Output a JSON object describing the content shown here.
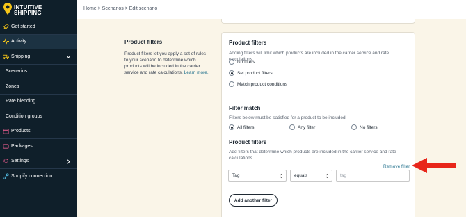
{
  "brand": {
    "line1": "INTUITIVE",
    "line2": "SHIPPING"
  },
  "sidebar": {
    "items": [
      {
        "label": "Get started",
        "icon": "rocket-icon"
      },
      {
        "label": "Activity",
        "icon": "pulse-icon"
      },
      {
        "label": "Shipping",
        "icon": "truck-icon"
      },
      {
        "label": "Scenarios"
      },
      {
        "label": "Zones"
      },
      {
        "label": "Rate blending"
      },
      {
        "label": "Condition groups"
      },
      {
        "label": "Products",
        "icon": "box-icon"
      },
      {
        "label": "Packages",
        "icon": "package-icon"
      },
      {
        "label": "Settings",
        "icon": "gear-icon"
      },
      {
        "label": "Shopify connection",
        "icon": "link-icon"
      }
    ]
  },
  "breadcrumb": "Home > Scenarios > Edit scenario",
  "description": {
    "title": "Product filters",
    "body": "Product filters let you apply a set of rules to your scenario to determine which products will be included in the carrier service and rate calculations.",
    "link": "Learn more."
  },
  "card": {
    "product_filters": {
      "title": "Product filters",
      "hint": "Adding filters will limit which products are included in the carrier service and rate calculations.",
      "options": [
        "No filters",
        "Set product filters",
        "Match product conditions"
      ],
      "selected": "Set product filters"
    },
    "filter_match": {
      "title": "Filter match",
      "hint": "Filters below must be satisfied for a product to be included.",
      "options": [
        "All filters",
        "Any filter",
        "No filters"
      ],
      "selected": "All filters"
    },
    "filters_list": {
      "title": "Product filters",
      "hint": "Add filters that determine which products are included in the carrier service and rate calculations.",
      "remove_link": "Remove filter",
      "row": {
        "field": "Tag",
        "operator": "equals",
        "value_placeholder": "tag"
      },
      "add_button": "Add another filter"
    }
  },
  "colors": {
    "sidebar": "#0f1f2a",
    "background": "#faf5e8",
    "link": "#1f6f8b",
    "annotation_arrow": "#e8261a"
  }
}
